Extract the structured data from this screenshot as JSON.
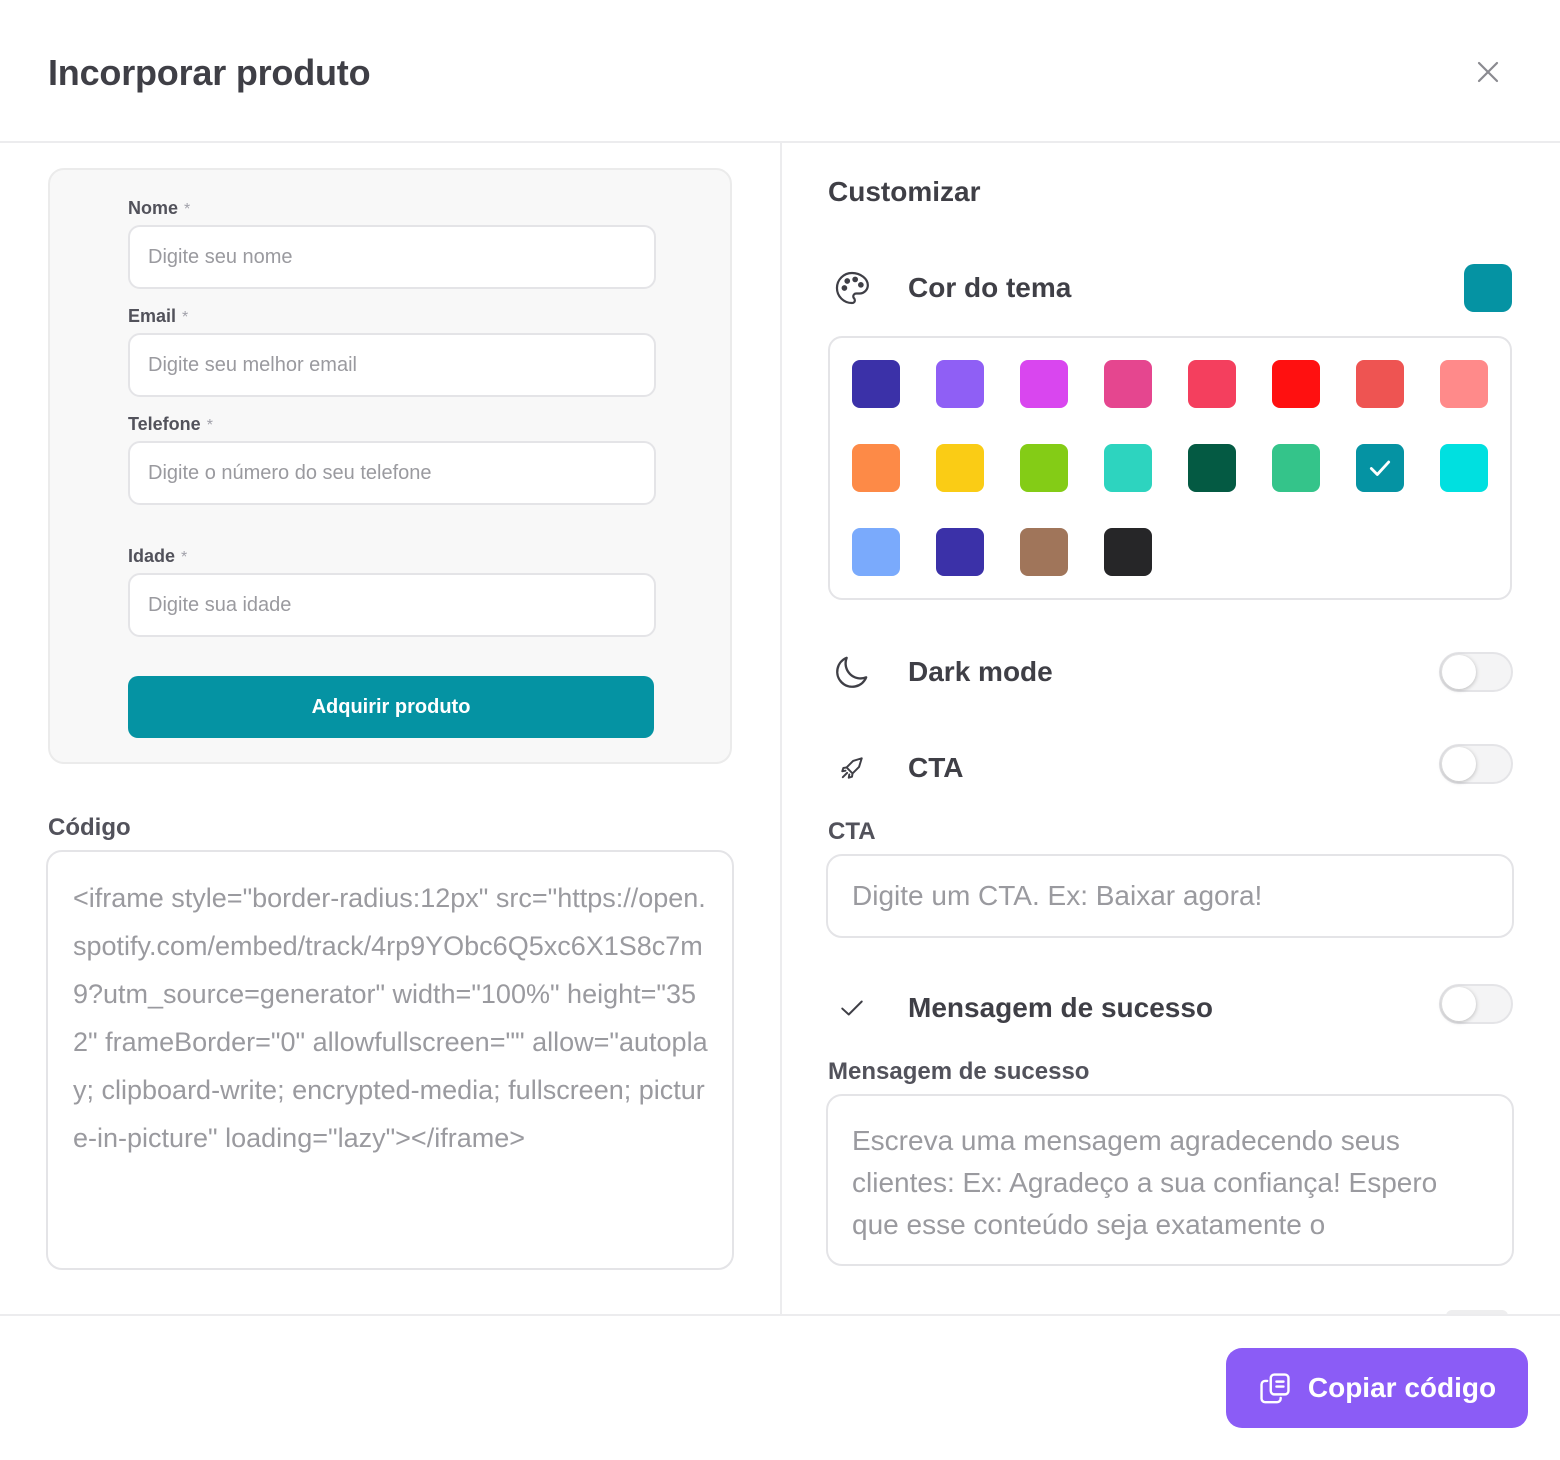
{
  "modal": {
    "title": "Incorporar produto",
    "close_icon": "close-icon"
  },
  "preview": {
    "fields": [
      {
        "label": "Nome",
        "required_mark": "*",
        "placeholder": "Digite seu nome"
      },
      {
        "label": "Email",
        "required_mark": "*",
        "placeholder": "Digite seu melhor email"
      },
      {
        "label": "Telefone",
        "required_mark": "*",
        "placeholder": "Digite o número do seu telefone"
      },
      {
        "label": "Idade",
        "required_mark": "*",
        "placeholder": "Digite sua idade"
      }
    ],
    "button_label": "Adquirir produto",
    "button_color": "#0593a3"
  },
  "code": {
    "label": "Código",
    "value": "<iframe style=\"border-radius:12px\" src=\"https://open.spotify.com/embed/track/4rp9YObc6Q5xc6X1S8c7m9?utm_source=generator\" width=\"100%\" height=\"352\" frameBorder=\"0\" allowfullscreen=\"\" allow=\"autoplay; clipboard-write; encrypted-media; fullscreen; picture-in-picture\" loading=\"lazy\"></iframe>"
  },
  "customize": {
    "title": "Customizar",
    "theme": {
      "label": "Cor do tema",
      "icon": "palette-icon",
      "selected_color": "#0593a3",
      "selected_index": 14,
      "colors": [
        "#3b31a8",
        "#8f5ff5",
        "#d946ef",
        "#e5468f",
        "#f43f5e",
        "#ff1010",
        "#ee5452",
        "#ff8a8a",
        "#fd8a47",
        "#facc15",
        "#84cc16",
        "#2dd4bf",
        "#045a43",
        "#34c48a",
        "#0593a3",
        "#00e0e0",
        "#7aaafc",
        "#3b31a8",
        "#a0755a",
        "#262628"
      ]
    },
    "dark_mode": {
      "label": "Dark mode",
      "icon": "moon-icon",
      "enabled": false
    },
    "cta": {
      "label": "CTA",
      "icon": "rocket-icon",
      "enabled": false,
      "field_label": "CTA",
      "placeholder": "Digite um CTA. Ex: Baixar agora!"
    },
    "success": {
      "label": "Mensagem de sucesso",
      "icon": "check-icon",
      "enabled": false,
      "field_label": "Mensagem de sucesso",
      "placeholder": "Escreva uma mensagem agradecendo seus clientes: Ex: Agradeço a sua confiança! Espero que esse conteúdo seja exatamente o"
    }
  },
  "footer": {
    "copy_label": "Copiar código",
    "copy_icon": "copy-icon",
    "copy_color": "#8b5cf6"
  }
}
